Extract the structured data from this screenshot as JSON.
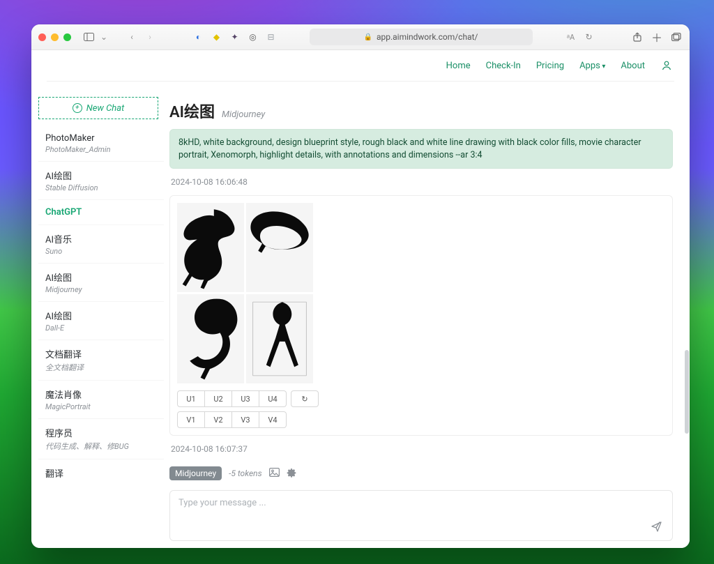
{
  "browser": {
    "url_display": "app.aimindwork.com/chat/"
  },
  "topnav": {
    "items": [
      "Home",
      "Check-In",
      "Pricing",
      "Apps",
      "About"
    ]
  },
  "sidebar": {
    "new_chat_label": "New Chat",
    "items": [
      {
        "title": "PhotoMaker",
        "subtitle": "PhotoMaker_Admin",
        "active": false
      },
      {
        "title": "AI绘图",
        "subtitle": "Stable Diffusion",
        "active": false
      },
      {
        "title": "ChatGPT",
        "subtitle": "",
        "active": true
      },
      {
        "title": "AI音乐",
        "subtitle": "Suno",
        "active": false
      },
      {
        "title": "AI绘图",
        "subtitle": "Midjourney",
        "active": false
      },
      {
        "title": "AI绘图",
        "subtitle": "Dall-E",
        "active": false
      },
      {
        "title": "文档翻译",
        "subtitle": "全文档翻译",
        "active": false
      },
      {
        "title": "魔法肖像",
        "subtitle": "MagicPortrait",
        "active": false
      },
      {
        "title": "程序员",
        "subtitle": "代码生成、解释、修BUG",
        "active": false
      },
      {
        "title": "翻译",
        "subtitle": "",
        "active": false
      }
    ]
  },
  "main": {
    "title": "AI绘图",
    "subtitle": "Midjourney",
    "prompt_text": "8kHD, white background, design blueprint style, rough black and white line drawing with black color fills, movie character portrait, Xenomorph, highlight details, with annotations and dimensions --ar 3:4",
    "timestamps": [
      "2024-10-08 16:06:48",
      "2024-10-08 16:07:37"
    ],
    "mj_buttons_row1": [
      "U1",
      "U2",
      "U3",
      "U4"
    ],
    "mj_refresh_label": "↻",
    "mj_buttons_row2": [
      "V1",
      "V2",
      "V3",
      "V4"
    ]
  },
  "composer": {
    "tag": "Midjourney",
    "tokens": "-5 tokens",
    "placeholder": "Type your message ...",
    "value": ""
  }
}
